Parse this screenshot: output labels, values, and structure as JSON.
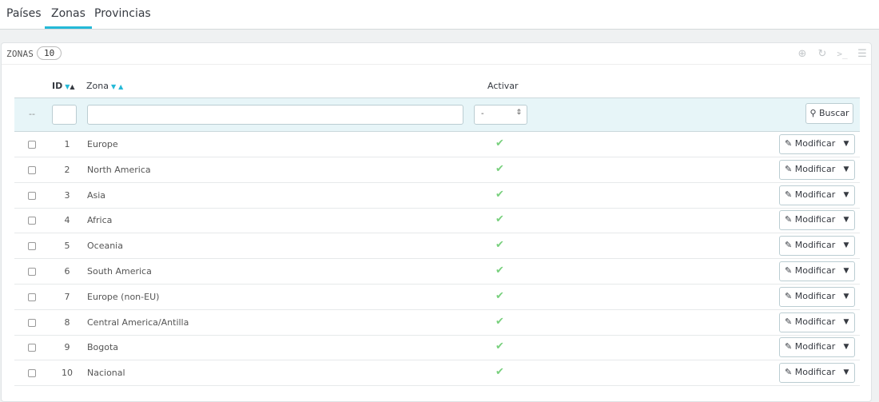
{
  "tabs": [
    {
      "label": "Países"
    },
    {
      "label": "Zonas"
    },
    {
      "label": "Provincias"
    }
  ],
  "panel": {
    "title": "ZONAS",
    "count": "10",
    "toolbar_icons": [
      "add-icon",
      "refresh-icon",
      "sql-icon",
      "database-icon"
    ]
  },
  "table": {
    "headers": {
      "id": "ID",
      "zona": "Zona",
      "activar": "Activar"
    },
    "filter": {
      "bulk_placeholder": "--",
      "active_select_value": "-",
      "search_label": "Buscar"
    },
    "rows": [
      {
        "id": "1",
        "zona": "Europe",
        "active": true,
        "action": "Modificar"
      },
      {
        "id": "2",
        "zona": "North America",
        "active": true,
        "action": "Modificar"
      },
      {
        "id": "3",
        "zona": "Asia",
        "active": true,
        "action": "Modificar"
      },
      {
        "id": "4",
        "zona": "Africa",
        "active": true,
        "action": "Modificar"
      },
      {
        "id": "5",
        "zona": "Oceania",
        "active": true,
        "action": "Modificar"
      },
      {
        "id": "6",
        "zona": "South America",
        "active": true,
        "action": "Modificar"
      },
      {
        "id": "7",
        "zona": "Europe (non-EU)",
        "active": true,
        "action": "Modificar"
      },
      {
        "id": "8",
        "zona": "Central America/Antilla",
        "active": true,
        "action": "Modificar"
      },
      {
        "id": "9",
        "zona": "Bogota",
        "active": true,
        "action": "Modificar"
      },
      {
        "id": "10",
        "zona": "Nacional",
        "active": true,
        "action": "Modificar"
      }
    ]
  },
  "colors": {
    "accent": "#25b9d7",
    "check": "#78d07d"
  }
}
